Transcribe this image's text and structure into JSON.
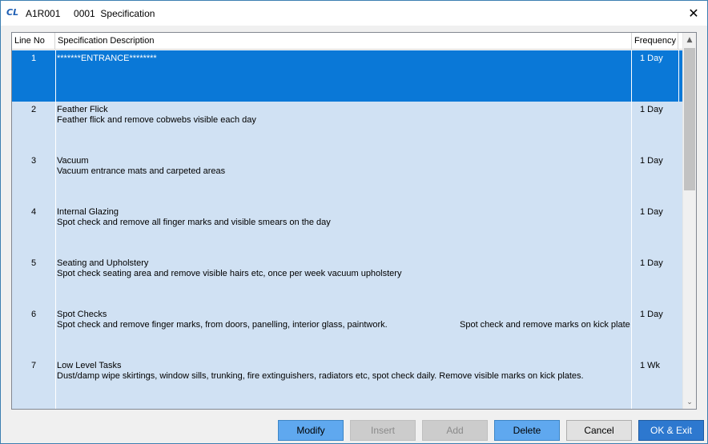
{
  "window": {
    "app_icon": "CL",
    "title": "A1R001     0001  Specification",
    "close_glyph": "✕"
  },
  "grid": {
    "columns": {
      "line_no": "Line No",
      "description": "Specification Description",
      "frequency": "Frequency"
    },
    "rows": [
      {
        "line": "1",
        "title": "*******ENTRANCE********",
        "detail": "",
        "extra": "",
        "frequency": "1  Day",
        "selected": true
      },
      {
        "line": "2",
        "title": "Feather Flick",
        "detail": "Feather flick and remove cobwebs visible each day",
        "extra": "",
        "frequency": "1  Day"
      },
      {
        "line": "3",
        "title": "Vacuum",
        "detail": "Vacuum entrance mats and carpeted areas",
        "extra": "",
        "frequency": "1  Day"
      },
      {
        "line": "4",
        "title": "Internal Glazing",
        "detail": "Spot check and remove all finger marks and visible smears on the day",
        "extra": "",
        "frequency": "1  Day"
      },
      {
        "line": "5",
        "title": "Seating and Upholstery",
        "detail": "Spot check seating area and remove visible hairs etc, once per week vacuum upholstery",
        "extra": "",
        "frequency": "1  Day"
      },
      {
        "line": "6",
        "title": "Spot Checks",
        "detail": "Spot check and remove finger marks, from doors, panelling, interior glass, paintwork.",
        "extra": "Spot check and remove marks on kick plate",
        "frequency": "1  Day"
      },
      {
        "line": "7",
        "title": "Low Level Tasks",
        "detail": "Dust/damp wipe skirtings, window sills, trunking, fire extinguishers, radiators etc, spot check daily. Remove visible marks on kick plates.",
        "extra": "",
        "frequency": "1  Wk"
      }
    ]
  },
  "scrollbar": {
    "up_glyph": "▲",
    "down_glyph": "⌄"
  },
  "buttons": {
    "modify": "Modify",
    "insert": "Insert",
    "add": "Add",
    "delete": "Delete",
    "cancel": "Cancel",
    "ok_exit": "OK & Exit"
  },
  "colors": {
    "row_background": "#d0e1f3",
    "selected_row": "#0a78d7",
    "ok_button": "#2d78cf"
  }
}
